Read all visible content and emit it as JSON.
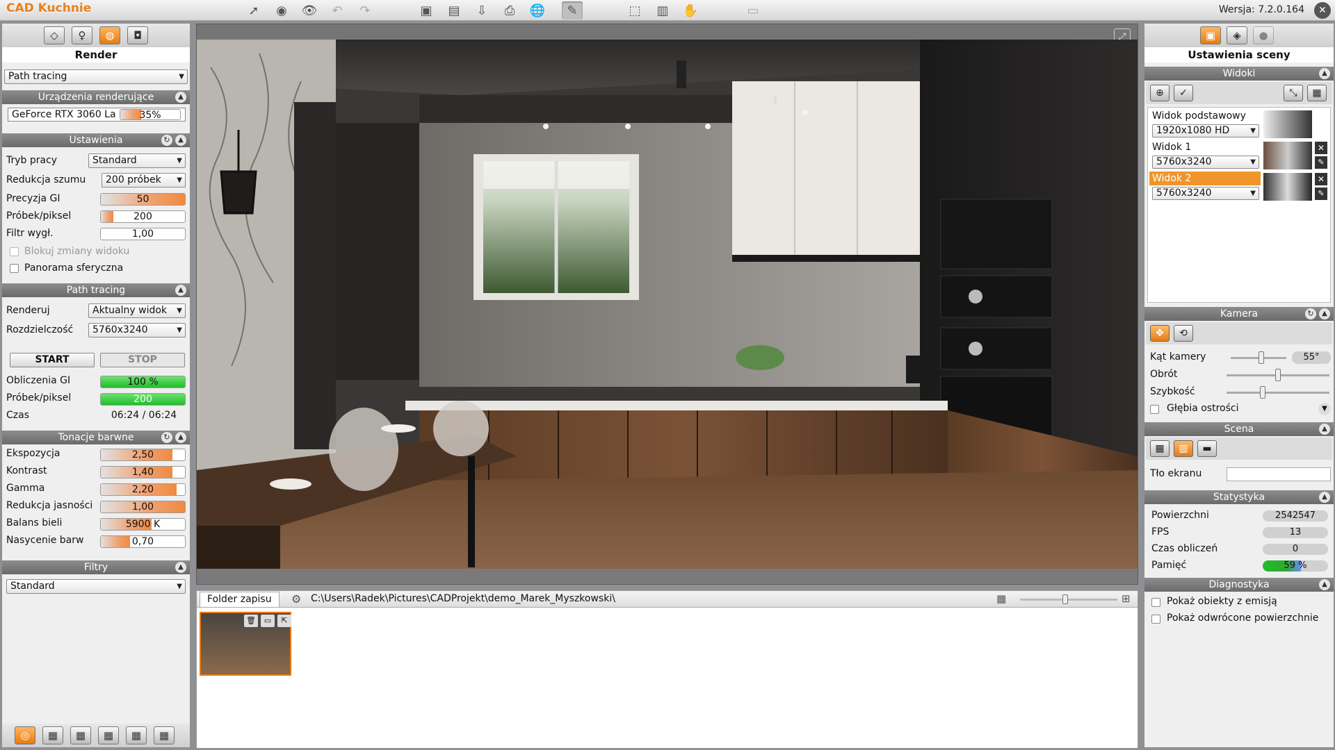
{
  "app": {
    "logo": "CAD Kuchnie",
    "version": "Wersja: 7.2.0.164"
  },
  "left_panel": {
    "title": "Render",
    "mode_select": "Path tracing",
    "devices": {
      "header": "Urządzenia renderujące",
      "gpu_name": "GeForce RTX 3060 La",
      "gpu_load_text": "35%",
      "gpu_load": 0.35
    },
    "settings": {
      "header": "Ustawienia",
      "rows": [
        {
          "label": "Tryb pracy",
          "value": "Standard",
          "kind": "select"
        },
        {
          "label": "Redukcja szumu",
          "value": "200 próbek",
          "kind": "select"
        },
        {
          "label": "Precyzja GI",
          "value": "50",
          "kind": "slider",
          "level": 1.0
        },
        {
          "label": "Próbek/piksel",
          "value": "200",
          "kind": "slider",
          "level": 0.15
        },
        {
          "label": "Filtr wygł.",
          "value": "1,00",
          "kind": "slider",
          "level": 0.0
        }
      ],
      "lock_view": "Blokuj zmiany widoku",
      "panorama": "Panorama sferyczna"
    },
    "path_tracing": {
      "header": "Path tracing",
      "render_label": "Renderuj",
      "render_value": "Aktualny widok",
      "resolution_label": "Rozdzielczość",
      "resolution_value": "5760x3240",
      "start": "START",
      "stop": "STOP",
      "gi_label": "Obliczenia GI",
      "gi_value": "100 %",
      "gi_level": 1.0,
      "spp_label": "Próbek/piksel",
      "spp_value": "200",
      "spp_level": 1.0,
      "time_label": "Czas",
      "time_value": "06:24 / 06:24"
    },
    "tone": {
      "header": "Tonacje barwne",
      "rows": [
        {
          "label": "Ekspozycja",
          "value": "2,50",
          "level": 0.85
        },
        {
          "label": "Kontrast",
          "value": "1,40",
          "level": 0.85
        },
        {
          "label": "Gamma",
          "value": "2,20",
          "level": 0.9
        },
        {
          "label": "Redukcja jasności",
          "value": "1,00",
          "level": 1.0
        },
        {
          "label": "Balans bieli",
          "value": "5900 K",
          "level": 0.6
        },
        {
          "label": "Nasycenie barw",
          "value": "0,70",
          "level": 0.35
        }
      ]
    },
    "filters": {
      "header": "Filtry",
      "value": "Standard"
    }
  },
  "bottom": {
    "tab": "Folder zapisu",
    "path": "C:\\Users\\Radek\\Pictures\\CADProjekt\\demo_Marek_Myszkowski\\"
  },
  "right_panel": {
    "title": "Ustawienia sceny",
    "views": {
      "header": "Widoki",
      "items": [
        {
          "name": "Widok podstawowy",
          "res": "1920x1080 HD",
          "selected": false
        },
        {
          "name": "Widok 1",
          "res": "5760x3240",
          "selected": false
        },
        {
          "name": "Widok 2",
          "res": "5760x3240",
          "selected": true
        }
      ]
    },
    "camera": {
      "header": "Kamera",
      "angle_label": "Kąt kamery",
      "angle_value": "55°",
      "angle_level": 0.55,
      "rotation_label": "Obrót",
      "rotation_level": 0.5,
      "speed_label": "Szybkość",
      "speed_level": 0.35,
      "dof_label": "Głębia ostrości"
    },
    "scene": {
      "header": "Scena",
      "bg_label": "Tło ekranu"
    },
    "stats": {
      "header": "Statystyka",
      "rows": [
        {
          "label": "Powierzchni",
          "value": "2542547"
        },
        {
          "label": "FPS",
          "value": "13"
        },
        {
          "label": "Czas obliczeń",
          "value": "0"
        },
        {
          "label": "Pamięć",
          "value": "59 %",
          "level": 0.59
        }
      ]
    },
    "diagnostics": {
      "header": "Diagnostyka",
      "emission": "Pokaż obiekty z emisją",
      "backfaces": "Pokaż odwrócone powierzchnie"
    }
  },
  "colors": {
    "accent": "#e8801a",
    "section_header": "#7a7a7a",
    "progress_green": "#1fbf2a",
    "selected_row": "#f0952c"
  }
}
